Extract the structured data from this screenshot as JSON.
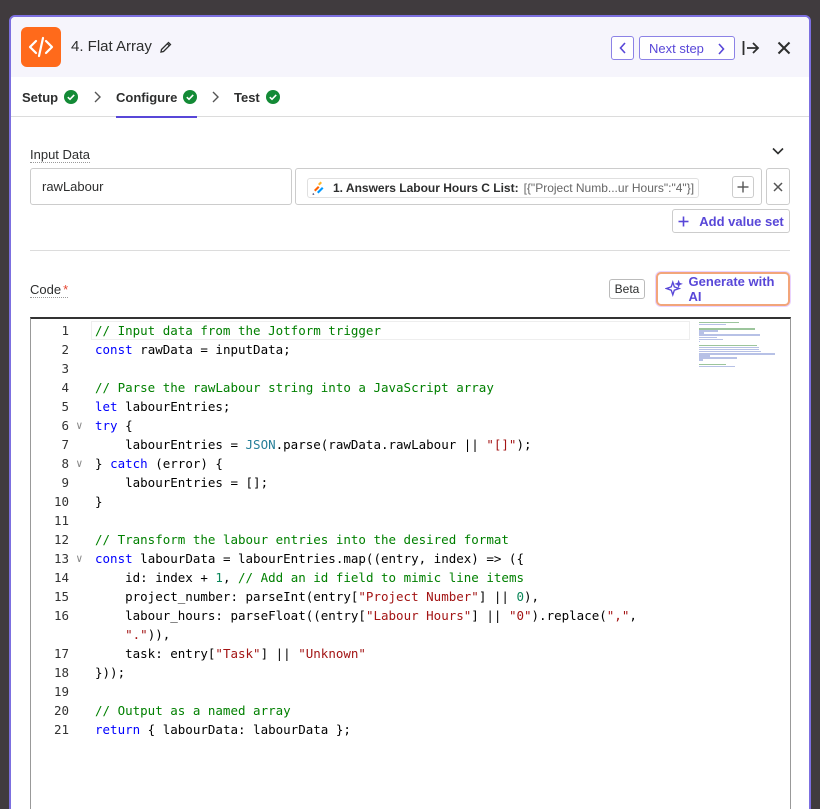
{
  "header": {
    "step_title": "4. Flat Array",
    "next_label": "Next step"
  },
  "tabs": [
    {
      "label": "Setup"
    },
    {
      "label": "Configure"
    },
    {
      "label": "Test"
    }
  ],
  "input_data": {
    "label": "Input Data",
    "key": "rawLabour",
    "value_label": "1. Answers Labour Hours C List:",
    "value_preview": "[{\"Project Numb...ur Hours\":\"4\"}]",
    "add_value_set_label": "Add value set"
  },
  "code_section": {
    "label": "Code",
    "required_mark": "*",
    "beta_label": "Beta",
    "generate_label": "Generate with AI"
  },
  "code_lines": [
    {
      "n": "1",
      "text": "// Input data from the Jotform trigger"
    },
    {
      "n": "2",
      "text": "const rawData = inputData;"
    },
    {
      "n": "3",
      "text": ""
    },
    {
      "n": "4",
      "text": "// Parse the rawLabour string into a JavaScript array"
    },
    {
      "n": "5",
      "text": "let labourEntries;"
    },
    {
      "n": "6",
      "text": "try {"
    },
    {
      "n": "7",
      "text": "    labourEntries = JSON.parse(rawData.rawLabour || \"[]\");"
    },
    {
      "n": "8",
      "text": "} catch (error) {"
    },
    {
      "n": "9",
      "text": "    labourEntries = [];"
    },
    {
      "n": "10",
      "text": "}"
    },
    {
      "n": "11",
      "text": ""
    },
    {
      "n": "12",
      "text": "// Transform the labour entries into the desired format"
    },
    {
      "n": "13",
      "text": "const labourData = labourEntries.map((entry, index) => ({"
    },
    {
      "n": "14",
      "text": "    id: index + 1, // Add an id field to mimic line items"
    },
    {
      "n": "15",
      "text": "    project_number: parseInt(entry[\"Project Number\"] || 0),"
    },
    {
      "n": "16",
      "text": "    labour_hours: parseFloat((entry[\"Labour Hours\"] || \"0\").replace(\",\","
    },
    {
      "n": "",
      "text": "    \".\")),"
    },
    {
      "n": "17",
      "text": "    task: entry[\"Task\"] || \"Unknown\""
    },
    {
      "n": "18",
      "text": "}));"
    },
    {
      "n": "19",
      "text": ""
    },
    {
      "n": "20",
      "text": "// Output as a named array"
    },
    {
      "n": "21",
      "text": "return { labourData: labourData };"
    }
  ],
  "colors": {
    "accent": "#5847d8",
    "app_icon": "#ff6a1b",
    "success": "#138a36",
    "panel_border": "#7c6fe0"
  }
}
